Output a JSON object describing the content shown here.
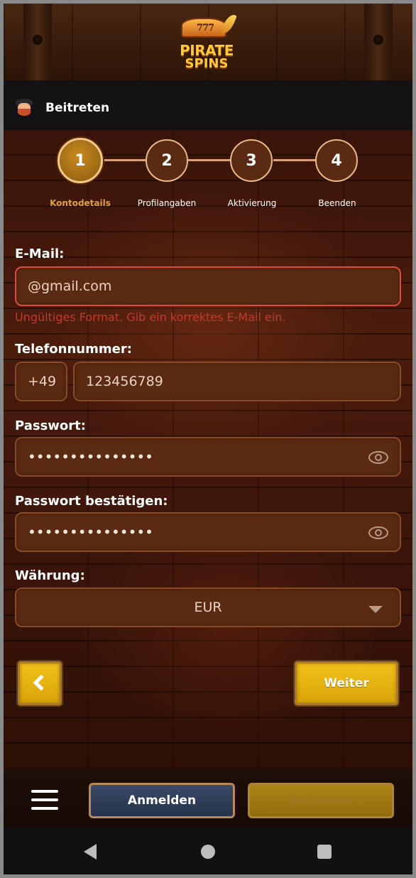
{
  "brand": {
    "logo_line1": "PIRATE",
    "logo_line2": "SPINS",
    "logo_sevens": "777"
  },
  "header": {
    "title": "Beitreten"
  },
  "stepper": {
    "steps": [
      {
        "number": "1",
        "label": "Kontodetails",
        "active": true
      },
      {
        "number": "2",
        "label": "Profilangaben",
        "active": false
      },
      {
        "number": "3",
        "label": "Aktivierung",
        "active": false
      },
      {
        "number": "4",
        "label": "Beenden",
        "active": false
      }
    ]
  },
  "form": {
    "email": {
      "label": "E-Mail:",
      "value": "@gmail.com",
      "error": "Ungültiges Format. Gib ein korrektes E-Mail ein."
    },
    "phone": {
      "label": "Telefonnummer:",
      "prefix": "+49",
      "value": "123456789"
    },
    "password": {
      "label": "Passwort:",
      "masked": "•••••••••••••••"
    },
    "password_confirm": {
      "label": "Passwort bestätigen:",
      "masked": "•••••••••••••••"
    },
    "currency": {
      "label": "Währung:",
      "value": "EUR"
    }
  },
  "navigation": {
    "next_label": "Weiter"
  },
  "bottom_bar": {
    "login_label": "Anmelden",
    "join_label": "Beitreten"
  },
  "colors": {
    "accent_gold": "#e0a040",
    "error_red": "#c23a2e",
    "button_yellow": "#f2c21a",
    "login_blue": "#2e3b55"
  }
}
